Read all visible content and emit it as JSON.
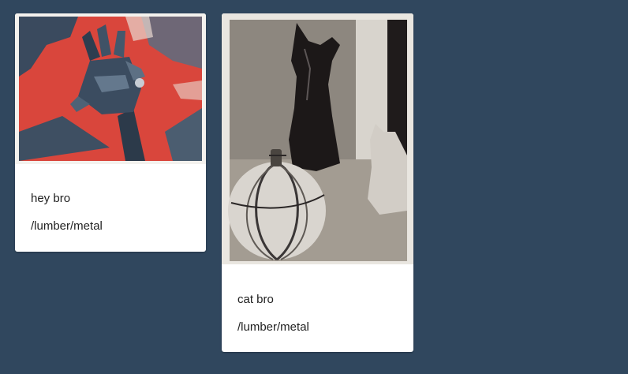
{
  "cards": [
    {
      "title": "hey bro",
      "path": "/lumber/metal"
    },
    {
      "title": "cat bro",
      "path": "/lumber/metal"
    }
  ],
  "colors": {
    "background": "#30475e",
    "card": "#ffffff",
    "accent_red": "#d9463c"
  }
}
